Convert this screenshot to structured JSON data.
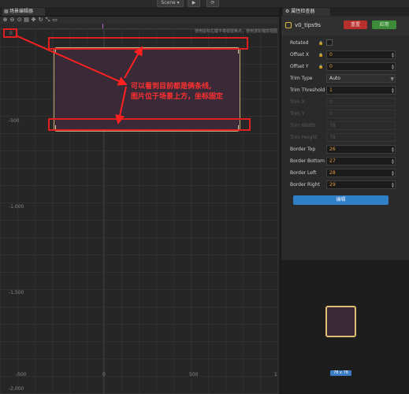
{
  "topbar": {
    "mode_label": "Scene ▾",
    "play": "▶",
    "refresh": "⟳"
  },
  "scene": {
    "tab_title": "场景编辑器",
    "hint": "使用鼠标右键平移视窗焦点，使用滚轮缩放视图",
    "origin_label": "0",
    "y_labels": [
      "-500",
      "-1,000",
      "-1,500",
      "-2,000"
    ],
    "x_labels": [
      "-500",
      "0",
      "500",
      "1"
    ],
    "annotation_line1": "可以看到目前都是俩条线,",
    "annotation_line2": "图片位于场景上方，坐标固定"
  },
  "inspector": {
    "tab_title": "属性检查器",
    "node_name": "v0_tips9s",
    "reset_label": "重置",
    "apply_label": "应用",
    "props": {
      "rotated": "Rotated",
      "offset_x": "Offset X",
      "offset_x_val": "0",
      "offset_y": "Offset Y",
      "offset_y_val": "0",
      "trim_type": "Trim Type",
      "trim_type_val": "Auto",
      "trim_threshold": "Trim Threshold",
      "trim_threshold_val": "1",
      "trim_x": "Trim X",
      "trim_x_val": "0",
      "trim_y": "Trim Y",
      "trim_y_val": "0",
      "trim_width": "Trim Width",
      "trim_width_val": "78",
      "trim_height": "Trim Height",
      "trim_height_val": "78",
      "border_top": "Border Top",
      "border_top_val": "26",
      "border_bottom": "Border Bottom",
      "border_bottom_val": "27",
      "border_left": "Border Left",
      "border_left_val": "28",
      "border_right": "Border Right",
      "border_right_val": "29"
    },
    "edit_label": "编辑",
    "preview_size": "78 x 78"
  },
  "colors": {
    "annotation": "#ff3030",
    "reset": "#b8302c",
    "apply": "#3d8c3a",
    "edit": "#2f7fc4"
  }
}
